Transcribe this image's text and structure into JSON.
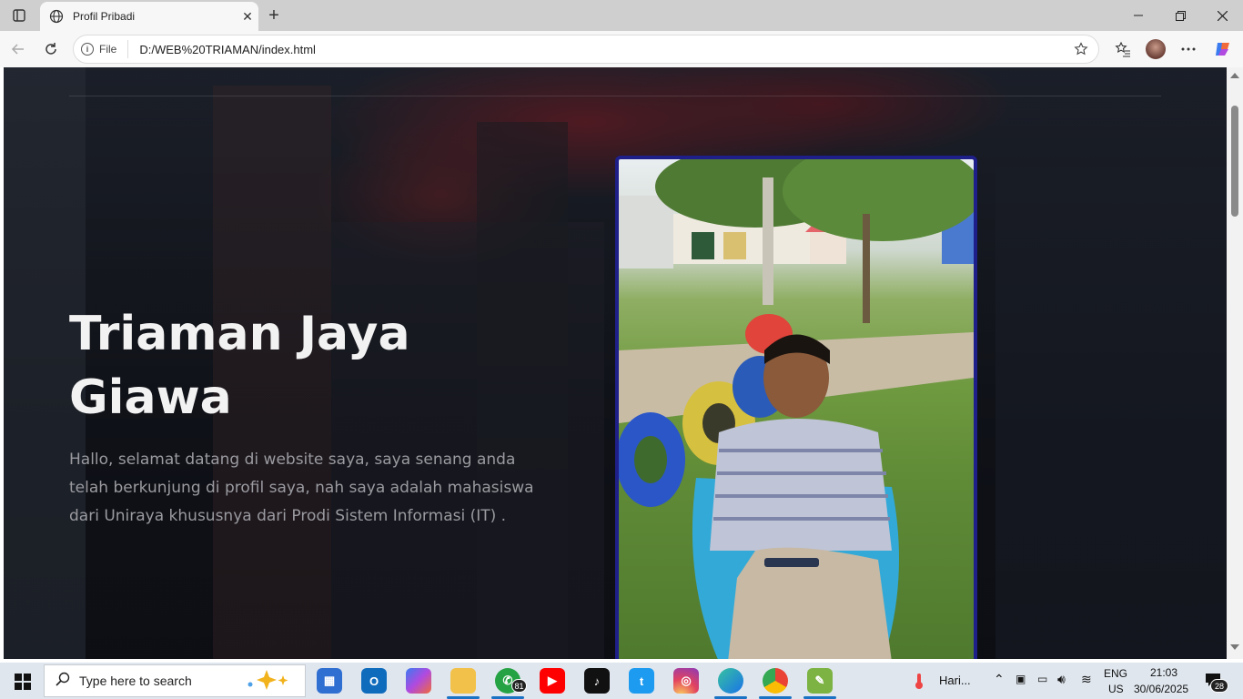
{
  "browser": {
    "tab_title": "Profil Pribadi",
    "address_chip": "File",
    "url": "D:/WEB%20TRIAMAN/index.html"
  },
  "page": {
    "name": "Triaman Jaya Giawa",
    "intro": "Hallo, selamat datang di website saya, saya senang anda telah berkunjung di profil saya, nah saya adalah mahasiswa dari Uniraya khususnya dari Prodi Sistem Informasi (IT) ."
  },
  "taskbar": {
    "search_placeholder": "Type here to search",
    "whatsapp_badge": "81",
    "weather_label": "Hari...",
    "lang_top": "ENG",
    "lang_bottom": "US",
    "time": "21:03",
    "date": "30/06/2025",
    "notif_count": "28"
  },
  "colors": {
    "photo_border": "#1f1f8a",
    "hero_text": "#f2f2f2",
    "intro_text": "#9a9aa0"
  }
}
